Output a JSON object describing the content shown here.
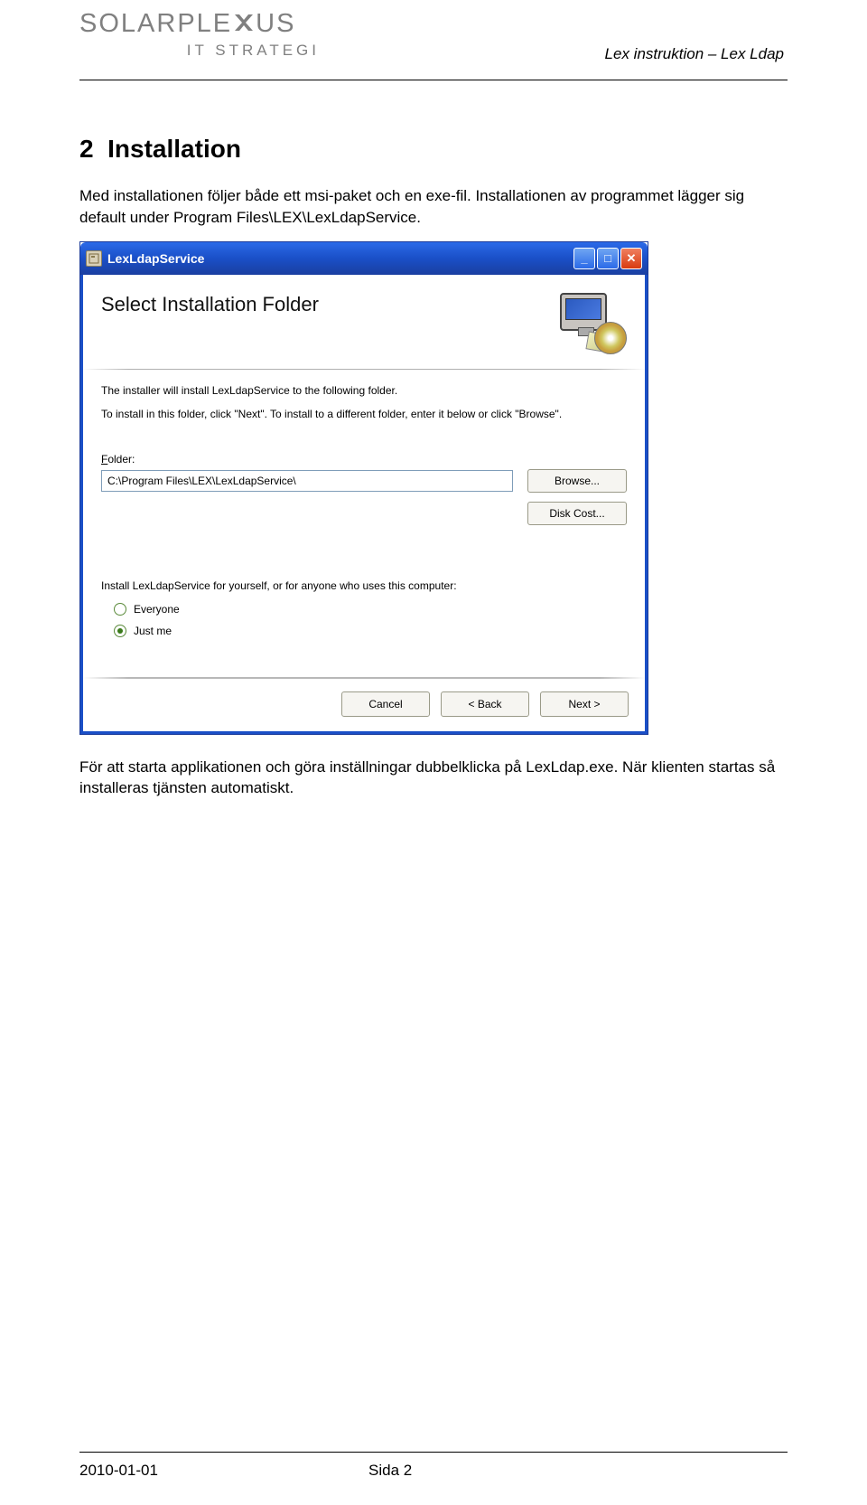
{
  "header": {
    "logoMain": "SOLARPLE",
    "logoMainAfter": "US",
    "logoSub": "IT STRATEGI",
    "titleRight": "Lex instruktion – Lex Ldap"
  },
  "section": {
    "number": "2",
    "title": "Installation",
    "para": "Med installationen följer både ett msi-paket och en exe-fil. Installationen av programmet lägger sig default under Program Files\\LEX\\LexLdapService."
  },
  "installer": {
    "windowTitle": "LexLdapService",
    "heading": "Select Installation Folder",
    "line1": "The installer will install LexLdapService to the following folder.",
    "line2": "To install in this folder, click \"Next\". To install to a different folder, enter it below or click \"Browse\".",
    "folderLabel": "Folder:",
    "folderValue": "C:\\Program Files\\LEX\\LexLdapService\\",
    "browse": "Browse...",
    "diskCost": "Disk Cost...",
    "scopeText": "Install LexLdapService for yourself, or for anyone who uses this computer:",
    "everyone": "Everyone",
    "justMe": "Just me",
    "cancel": "Cancel",
    "back": "< Back",
    "next": "Next >"
  },
  "after": {
    "para": "För att starta applikationen och göra inställningar dubbelklicka på LexLdap.exe. När klienten startas så installeras tjänsten automatiskt."
  },
  "footer": {
    "date": "2010-01-01",
    "page": "Sida 2"
  }
}
